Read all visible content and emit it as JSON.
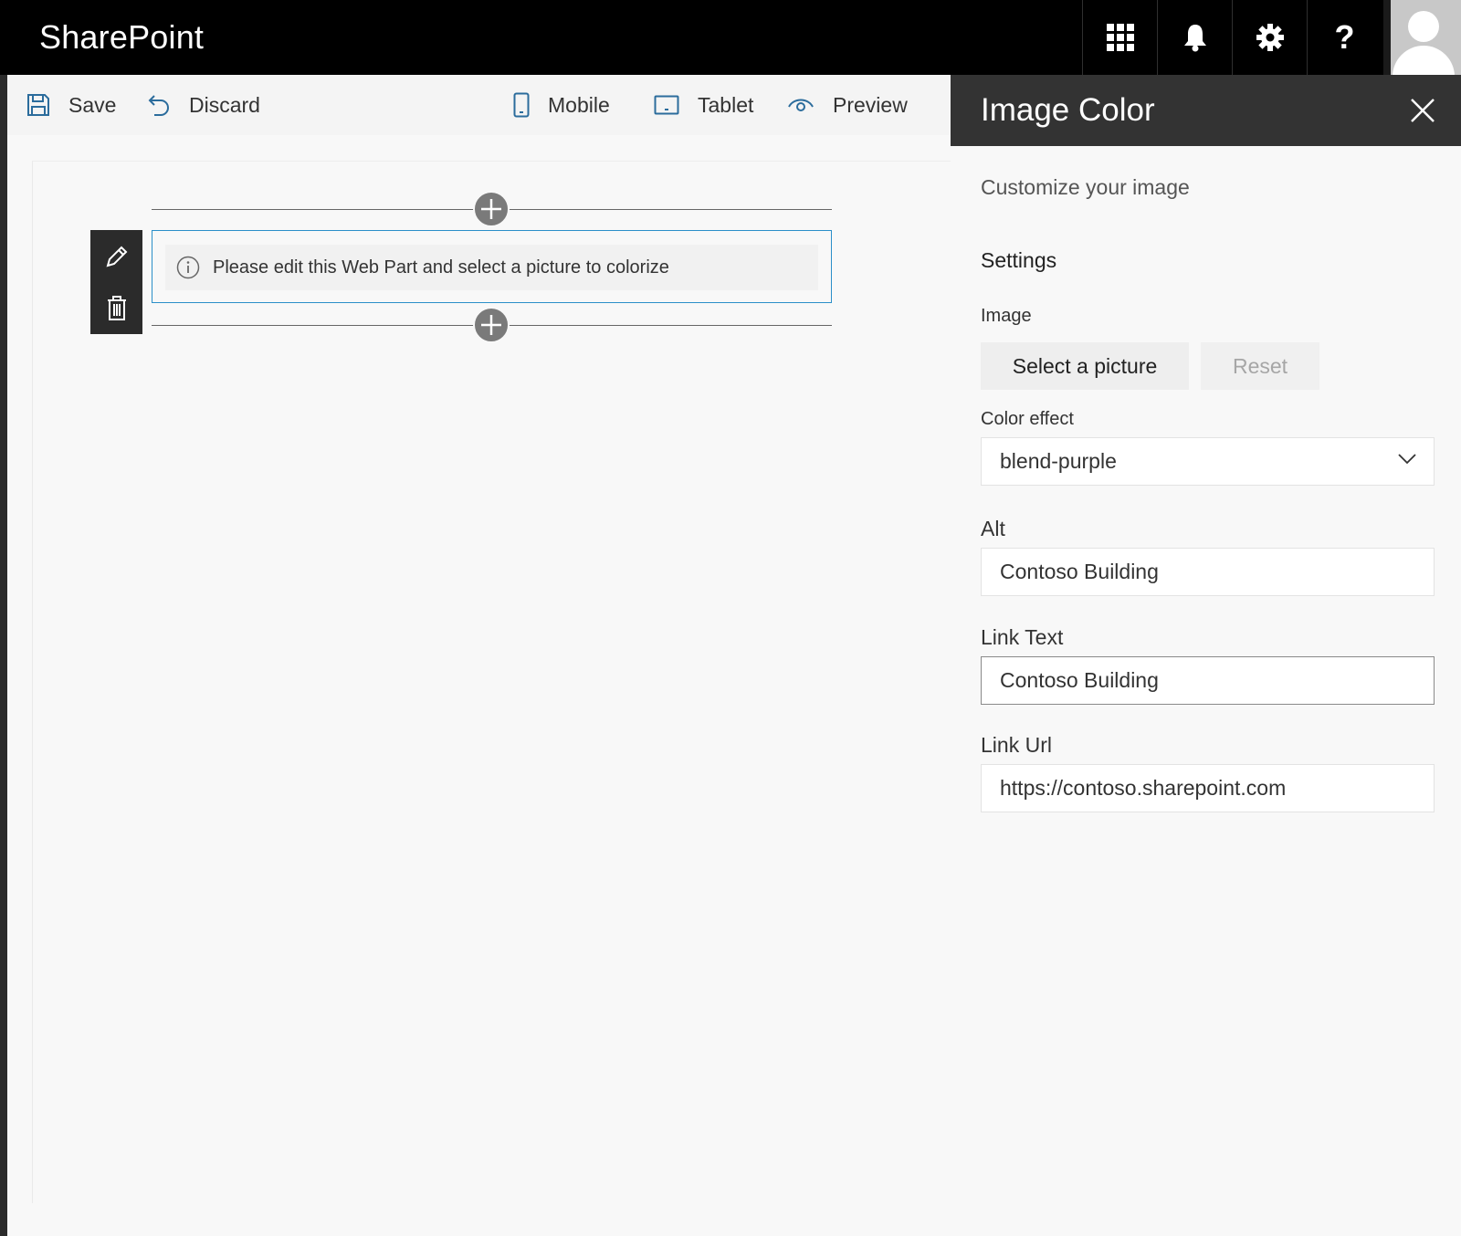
{
  "suitebar": {
    "brand": "SharePoint",
    "icons": [
      "app-launcher-icon",
      "bell-icon",
      "gear-icon",
      "help-icon"
    ],
    "help_label": "?"
  },
  "command_bar": {
    "save": "Save",
    "discard": "Discard",
    "mobile": "Mobile",
    "tablet": "Tablet",
    "preview": "Preview"
  },
  "canvas": {
    "webpart_message": "Please edit this Web Part and select a picture to colorize"
  },
  "pane": {
    "title": "Image Color",
    "description": "Customize your image",
    "group_title": "Settings",
    "image_label": "Image",
    "select_button": "Select a picture",
    "reset_button": "Reset",
    "color_effect_label": "Color effect",
    "color_effect_value": "blend-purple",
    "alt_label": "Alt",
    "alt_value": "Contoso Building",
    "link_text_label": "Link Text",
    "link_text_value": "Contoso Building",
    "link_url_label": "Link Url",
    "link_url_value": "https://contoso.sharepoint.com"
  },
  "colors": {
    "suitebar": "#000000",
    "pane_header": "#333333",
    "accent_border": "#2b8fc9",
    "background": "#f8f8f8"
  }
}
